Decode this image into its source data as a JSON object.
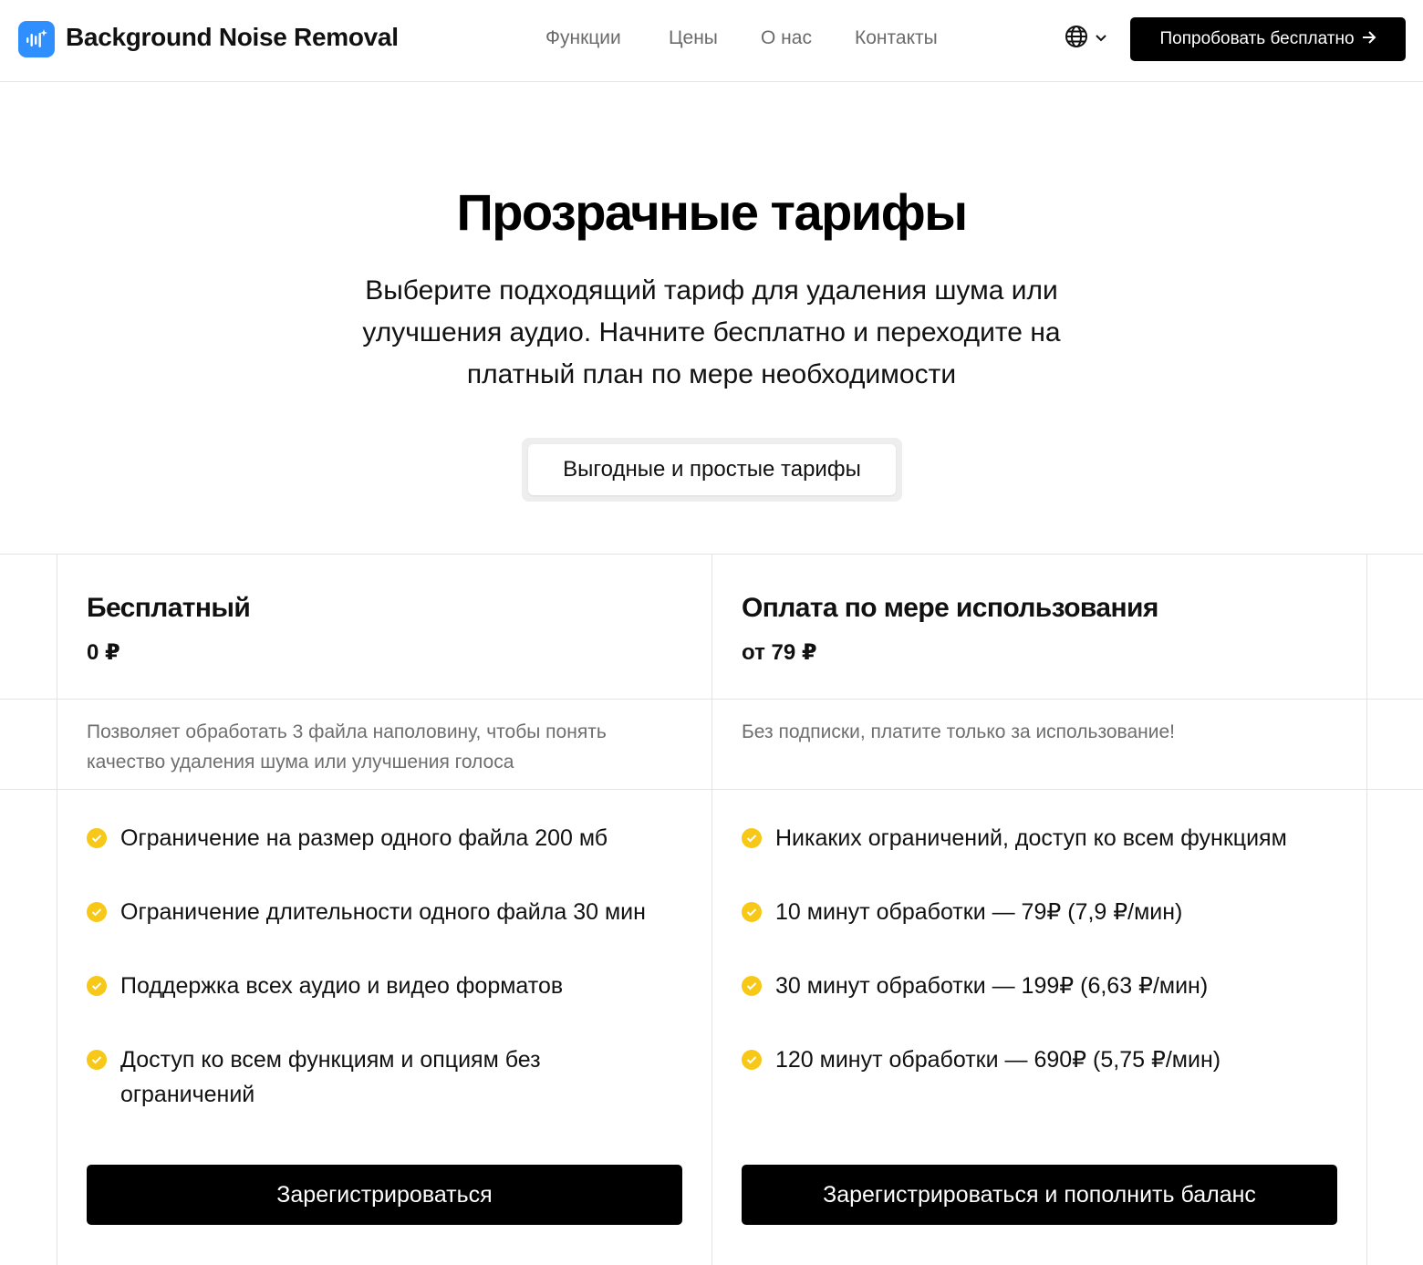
{
  "header": {
    "brand": "Background Noise Removal",
    "nav": [
      "Функции",
      "Цены",
      "О нас",
      "Контакты"
    ],
    "language_icon": "globe-icon",
    "cta_label": "Попробовать бесплатно"
  },
  "hero": {
    "title": "Прозрачные тарифы",
    "subtitle": "Выберите подходящий тариф для удаления шума или улучшения аудио. Начните бесплатно и переходите на платный план по мере необходимости",
    "pill_label": "Выгодные и простые тарифы"
  },
  "plans": [
    {
      "name": "Бесплатный",
      "price": "0 ₽",
      "description": "Позволяет обработать 3 файла наполовину, чтобы понять качество удаления шума или улучшения голоса",
      "features": [
        "Ограничение на размер одного файла 200 мб",
        "Ограничение длительности одного файла 30 мин",
        "Поддержка всех аудио и видео форматов",
        "Доступ ко всем функциям и опциям без ограничений"
      ],
      "button_label": "Зарегистрироваться"
    },
    {
      "name": "Оплата по мере использования",
      "price": "от 79 ₽",
      "description": "Без подписки, платите только за использование!",
      "features": [
        "Никаких ограничений, доступ ко всем функциям",
        "10 минут обработки — 79₽ (7,9 ₽/мин)",
        "30 минут обработки — 199₽ (6,63 ₽/мин)",
        "120 минут обработки — 690₽ (5,75 ₽/мин)"
      ],
      "button_label": "Зарегистрироваться и пополнить баланс"
    }
  ],
  "colors": {
    "brand_icon": "#2f8fff",
    "check": "#f7c817",
    "button": "#000000"
  }
}
